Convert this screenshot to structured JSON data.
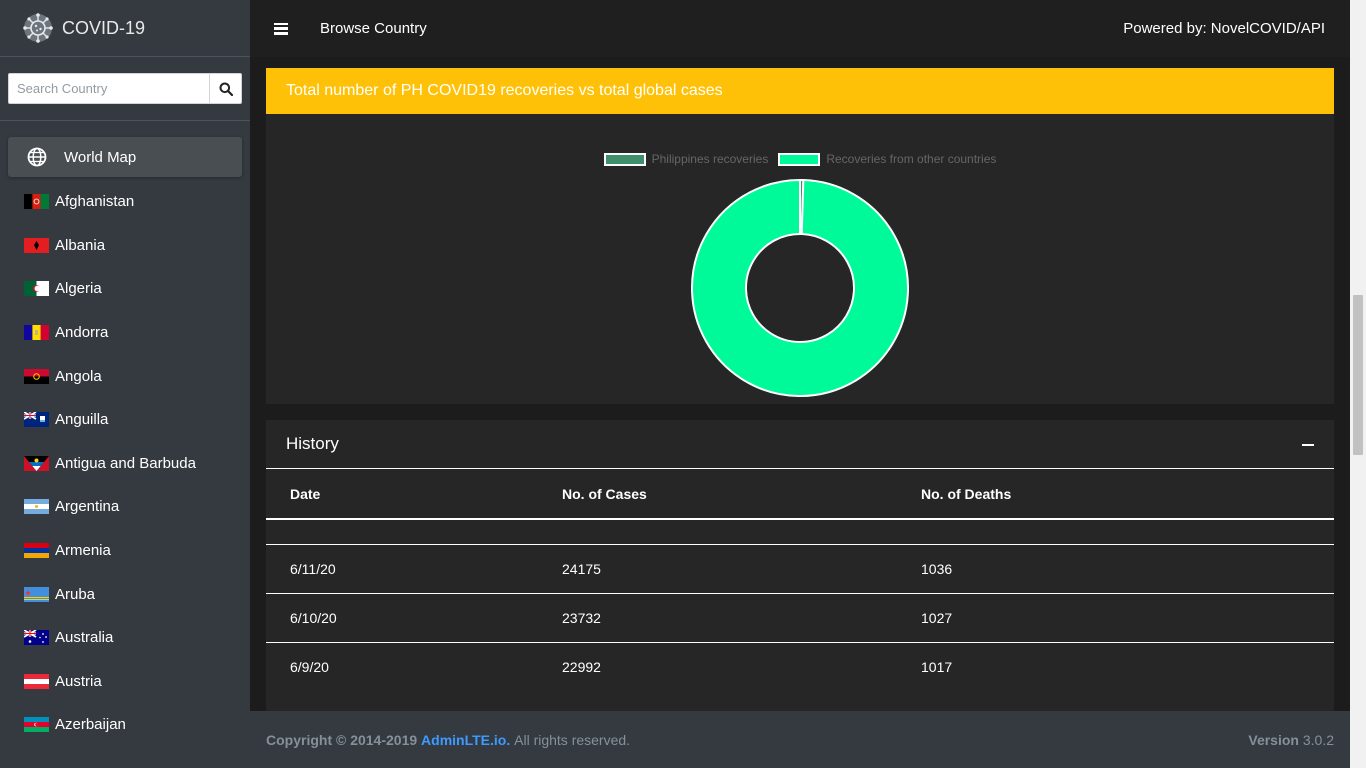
{
  "brand": {
    "title": "COVID-19"
  },
  "search": {
    "placeholder": "Search Country"
  },
  "sidebar": {
    "world_map_label": "World Map",
    "countries": [
      {
        "label": "Afghanistan"
      },
      {
        "label": "Albania"
      },
      {
        "label": "Algeria"
      },
      {
        "label": "Andorra"
      },
      {
        "label": "Angola"
      },
      {
        "label": "Anguilla"
      },
      {
        "label": "Antigua and Barbuda"
      },
      {
        "label": "Argentina"
      },
      {
        "label": "Armenia"
      },
      {
        "label": "Aruba"
      },
      {
        "label": "Australia"
      },
      {
        "label": "Austria"
      },
      {
        "label": "Azerbaijan"
      }
    ]
  },
  "topbar": {
    "page_title": "Browse Country",
    "powered_by": "Powered by: NovelCOVID/API"
  },
  "chart_card": {
    "title": "Total number of PH COVID19 recoveries vs total global cases",
    "colors": {
      "header": "#ffc107",
      "ph": "#3f8f6d",
      "other": "#00fa9a"
    }
  },
  "chart_data": {
    "type": "pie",
    "variant": "doughnut",
    "labels": [
      "Philippines recoveries",
      "Recoveries from other countries"
    ],
    "values": [
      0.5,
      99.5
    ],
    "legend": "top"
  },
  "history": {
    "title": "History",
    "columns": [
      "Date",
      "No. of Cases",
      "No. of Deaths"
    ],
    "rows": [
      [
        "6/11/20",
        "24175",
        "1036"
      ],
      [
        "6/10/20",
        "23732",
        "1027"
      ],
      [
        "6/9/20",
        "22992",
        "1017"
      ]
    ]
  },
  "footer": {
    "copyright": "Copyright © 2014-2019 ",
    "link": "AdminLTE.io.",
    "rights": " All rights reserved.",
    "version_label": "Version",
    "version": " 3.0.2"
  }
}
